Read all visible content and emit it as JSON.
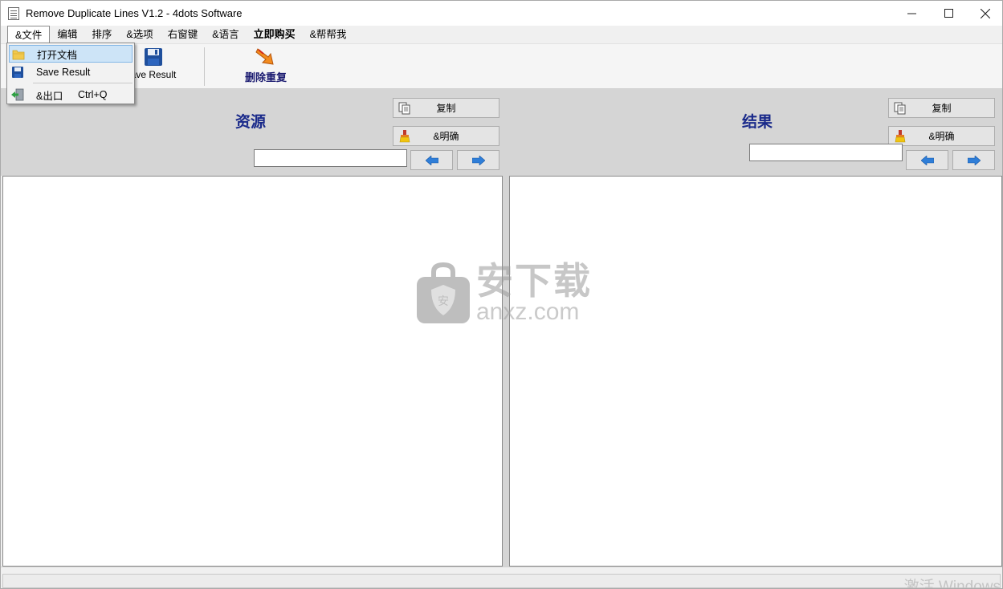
{
  "window": {
    "title": "Remove Duplicate Lines V1.2 - 4dots Software"
  },
  "window_controls": {
    "minimize": "—",
    "maximize": "☐",
    "close": "✕"
  },
  "menubar": {
    "items": [
      {
        "label": "&文件"
      },
      {
        "label": "编辑"
      },
      {
        "label": "排序"
      },
      {
        "label": "&选项"
      },
      {
        "label": "右窗键"
      },
      {
        "label": "&语言"
      },
      {
        "label": "立即购买"
      },
      {
        "label": "&帮帮我"
      }
    ]
  },
  "file_menu": {
    "items": [
      {
        "label": "打开文档",
        "shortcut": ""
      },
      {
        "label": "Save Result",
        "shortcut": ""
      },
      {
        "label": "&出口",
        "shortcut": "Ctrl+Q"
      }
    ]
  },
  "toolbar": {
    "save_label": "Save Result",
    "save_visible_label": "ave Result",
    "remove_label": "删除重复"
  },
  "left_panel": {
    "title": "资源",
    "copy_label": "复制",
    "clear_label": "&明确",
    "search_value": ""
  },
  "right_panel": {
    "title": "结果",
    "copy_label": "复制",
    "clear_label": "&明确",
    "search_value": ""
  },
  "watermark": {
    "cn": "安下载",
    "en": "anxz.com"
  },
  "status": {
    "activate": "激活 Windows"
  },
  "colors": {
    "accent_title": "#1a2a8a",
    "menu_highlight": "#cde4f7",
    "panel_header_bg": "#d5d5d5"
  }
}
